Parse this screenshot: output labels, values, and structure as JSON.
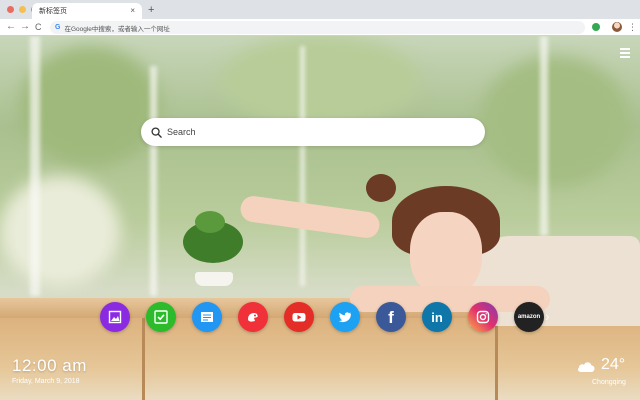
{
  "browser": {
    "tab_title": "新标签页",
    "tab_close": "×",
    "new_tab": "+",
    "back": "←",
    "forward": "→",
    "reload": "C",
    "omnibox_icon": "G",
    "omnibox_placeholder": "在Google中搜索，或者输入一个网址",
    "menu": "⋮",
    "traffic_lights": [
      "#ed6a5e",
      "#f5bf4f",
      "#61c554"
    ]
  },
  "search": {
    "placeholder": "Search"
  },
  "shortcuts": [
    {
      "name": "photo-editor",
      "icon": "image-icon",
      "color": "#8a2be2"
    },
    {
      "name": "checklist",
      "icon": "check-icon",
      "color": "#2bbb2b"
    },
    {
      "name": "notes",
      "icon": "note-icon",
      "color": "#2196f3"
    },
    {
      "name": "game",
      "icon": "gamepad-icon",
      "color": "#f0313a"
    },
    {
      "name": "youtube",
      "icon": "youtube-icon",
      "color": "#e52d27"
    },
    {
      "name": "twitter",
      "icon": "twitter-icon",
      "color": "#1da1f2"
    },
    {
      "name": "facebook",
      "icon": "facebook-icon",
      "color": "#3b5998",
      "letter": "f"
    },
    {
      "name": "linkedin",
      "icon": "linkedin-icon",
      "color": "#0e76a8",
      "letter": "in"
    },
    {
      "name": "instagram",
      "icon": "instagram-icon",
      "color": "#c13584"
    },
    {
      "name": "amazon",
      "icon": "amazon-icon",
      "color": "#222222",
      "letter": "amazon"
    }
  ],
  "next_arrow": "›",
  "clock": {
    "time": "12:00 am",
    "date": "Friday, March 9, 2018"
  },
  "weather": {
    "temperature": "24°",
    "city": "Chongqing"
  }
}
